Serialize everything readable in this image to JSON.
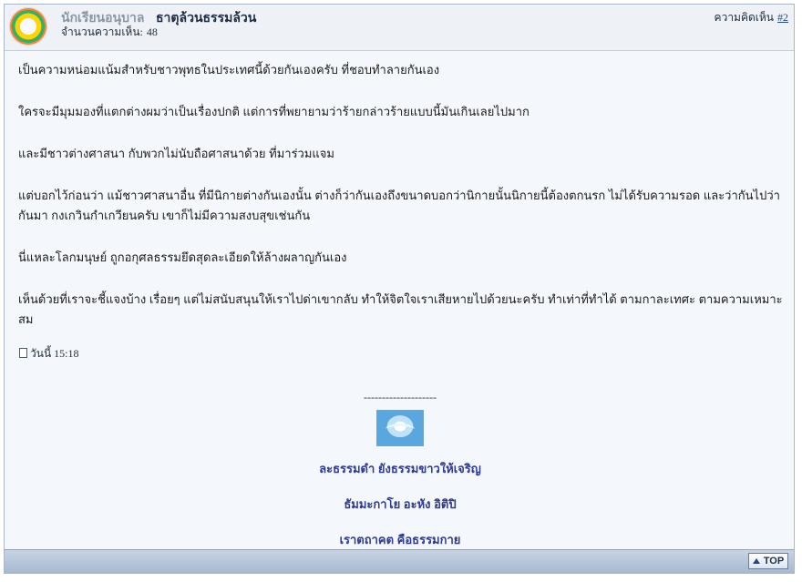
{
  "post": {
    "rank_title": "นักเรียนอนุบาล",
    "username": "ธาตุล้วนธรรมล้วน",
    "post_count_label": "จำนวนความเห็น:",
    "post_count": "48",
    "comment_label": "ความคิดเห็น",
    "comment_number": "#2"
  },
  "message": {
    "paragraphs": [
      "เป็นความหน่อมแน้มสำหรับชาวพุทธในประเทศนี้ด้วยกันเองครับ ที่ชอบทำลายกันเอง",
      "ใครจะมีมุมมองที่แตกต่างผมว่าเป็นเรื่องปกติ แต่การที่พยายามว่าร้ายกล่าวร้ายแบบนี้มันเกินเลยไปมาก",
      "และมีชาวต่างศาสนา กับพวกไม่นับถือศาสนาด้วย ที่มาร่วมแจม",
      "แต่บอกไว้ก่อนว่า แม้ชาวศาสนาอื่น ที่มีนิกายต่างกันเองนั้น ต่างก็ว่ากันเองถึงขนาดบอกว่านิกายนั้นนิกายนี้ต้องตกนรก ไม่ได้รับความรอด และว่ากันไปว่ากันมา กงเกวินกำเกวียนครับ เขาก็ไม่มีความสงบสุขเช่นกัน",
      "นี่แหละโลกมนุษย์ ถูกอกุศลธรรมยึดสุดละเอียดให้ล้างผลาญกันเอง",
      "เห็นด้วยที่เราจะชี้แจงบ้าง เรื่อยๆ แต่ไม่สนับสนุนให้เราไปด่าเขากลับ ทำให้จิตใจเราเสียหายไปด้วยนะครับ ทำเท่าที่ทำได้ ตามกาละเทศะ ตามความเหมาะสม"
    ],
    "timestamp": "วันนี้ 15:18"
  },
  "signature": {
    "divider": "--------------------",
    "lines": [
      "ละธรรมดำ ยังธรรมขาวให้เจริญ",
      "ธัมมะกาโย อะหัง อิติปิ",
      "เราตถาคต คือธรรมกาย"
    ]
  },
  "footer": {
    "top_label": "TOP"
  },
  "colors": {
    "header_bg": "#eef2f7",
    "body_bg": "#f4f7fb",
    "footer_bg": "#b9c8da",
    "signature_text": "#2f3b8f",
    "link": "#254c8a"
  },
  "icons": [
    "avatar-emblem",
    "document-icon",
    "signature-image",
    "arrow-up-icon"
  ]
}
